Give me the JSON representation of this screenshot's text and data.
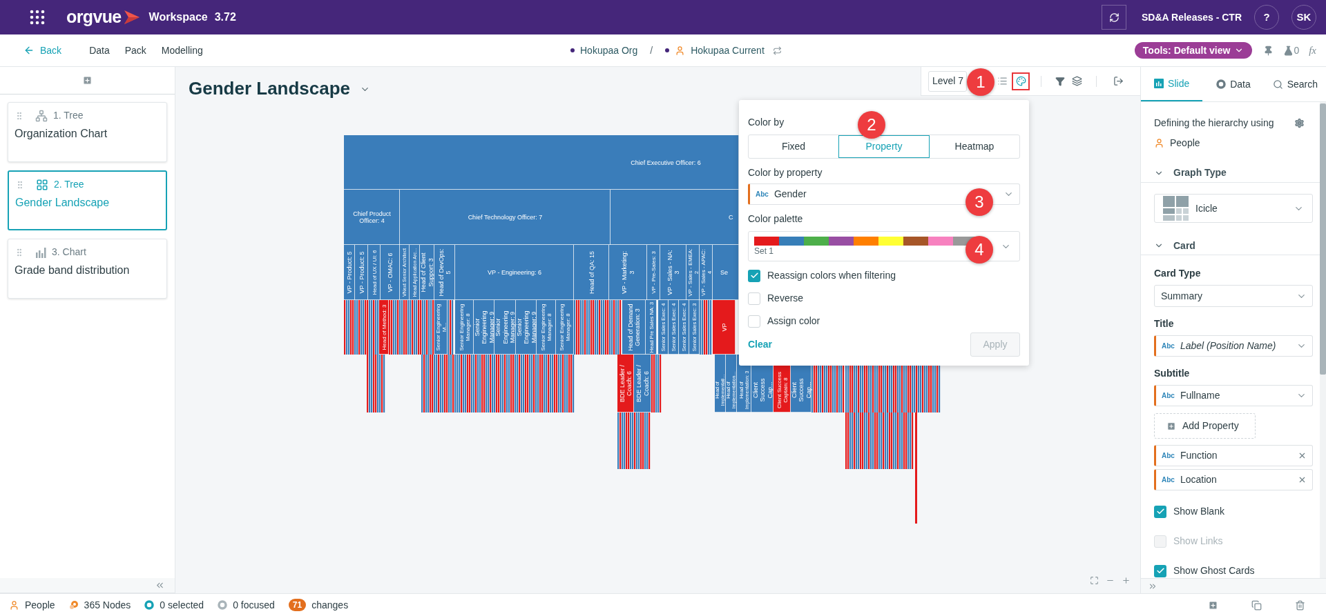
{
  "app": {
    "logo": "orgvue",
    "product": "Workspace",
    "version": "3.72",
    "workspace": "SD&A Releases - CTR",
    "help": "?",
    "user_initials": "SK"
  },
  "nav": {
    "back": "Back",
    "links": [
      "Data",
      "Pack",
      "Modelling"
    ],
    "breadcrumb": [
      {
        "kind": "org",
        "label": "Hokupaa Org"
      },
      {
        "kind": "dataset",
        "label": "Hokupaa Current"
      }
    ],
    "separator": "/",
    "tools": "Tools: Default view",
    "flask_count": "0",
    "fx": "fx"
  },
  "slides": [
    {
      "kind": "tree",
      "number": "1. Tree",
      "title": "Organization Chart",
      "selected": false
    },
    {
      "kind": "icicle",
      "number": "2. Tree",
      "title": "Gender Landscape",
      "selected": true
    },
    {
      "kind": "chart",
      "number": "3. Chart",
      "title": "Grade band distribution",
      "selected": false
    }
  ],
  "canvas": {
    "title": "Gender Landscape",
    "level": "Level 7"
  },
  "icicle": {
    "nodes": [
      {
        "label": "Chief Executive Officer: 6",
        "color": "#3a7dba"
      },
      {
        "label": "Chief Product Officer: 4",
        "color": "#3a7dba"
      },
      {
        "label": "Chief Technology Officer: 7",
        "color": "#3a7dba"
      },
      {
        "label": "C",
        "color": "#3a7dba"
      },
      {
        "label": "VP - Product: 5",
        "color": "#3a7dba"
      },
      {
        "label": "VP - Product: 5",
        "color": "#3a7dba"
      },
      {
        "label": "Head of UX / UI: 6",
        "color": "#3a7dba"
      },
      {
        "label": "VP - OMAC: 6",
        "color": "#3a7dba"
      },
      {
        "label": "VNext Senior Architect",
        "color": "#3a7dba"
      },
      {
        "label": "Head Application Arc...",
        "color": "#3a7dba"
      },
      {
        "label": "Head of Client Support: 3",
        "color": "#3a7dba"
      },
      {
        "label": "Head of DevOps: 5",
        "color": "#3a7dba"
      },
      {
        "label": "VP - Engineering: 6",
        "color": "#3a7dba"
      },
      {
        "label": "Head of QA: 15",
        "color": "#3a7dba"
      },
      {
        "label": "VP - Marketing: 3",
        "color": "#3a7dba"
      },
      {
        "label": "VP - Pre-Sales: 3",
        "color": "#3a7dba"
      },
      {
        "label": "VP - Sales - NA: 3",
        "color": "#3a7dba"
      },
      {
        "label": "VP - Sales - EMEA: 2",
        "color": "#3a7dba"
      },
      {
        "label": "VP - Sales - APAC: 4",
        "color": "#3a7dba"
      },
      {
        "label": "Se",
        "color": "#3a7dba"
      },
      {
        "label": "Head of Method: 3",
        "color": "#e41a1c"
      },
      {
        "label": "Senior Engineering M...",
        "color": "#3a7dba"
      },
      {
        "label": "Senior Engineering Manager: 8",
        "color": "#3a7dba"
      },
      {
        "label": "Senior Engineering Manager: 9",
        "color": "#3a7dba"
      },
      {
        "label": "Senior Engineering Manager: 9",
        "color": "#3a7dba"
      },
      {
        "label": "Senior Engineering Manager: 9",
        "color": "#3a7dba"
      },
      {
        "label": "Senior Engineering Manager: 8",
        "color": "#3a7dba"
      },
      {
        "label": "Senior Engineering Manager: 8",
        "color": "#3a7dba"
      },
      {
        "label": "Head of Demand Generation: 3",
        "color": "#3a7dba"
      },
      {
        "label": "Head Pre Sales NA: 3",
        "color": "#3a7dba"
      },
      {
        "label": "Senior Sales Exec: 4",
        "color": "#3a7dba"
      },
      {
        "label": "Senior Sales Exec: 4",
        "color": "#3a7dba"
      },
      {
        "label": "Senior Sales Exec: 4",
        "color": "#3a7dba"
      },
      {
        "label": "Senior Sales Exec: 3",
        "color": "#3a7dba"
      },
      {
        "label": "VP",
        "color": "#e41a1c"
      },
      {
        "label": "BDE Leader / Coach: 6",
        "color": "#e41a1c"
      },
      {
        "label": "BDE Leader / Coach: 6",
        "color": "#3a7dba"
      },
      {
        "label": "Head of Implementati...",
        "color": "#3a7dba"
      },
      {
        "label": "Head of Implementation...",
        "color": "#3a7dba"
      },
      {
        "label": "Head of Implementation: 3",
        "color": "#3a7dba"
      },
      {
        "label": "Client Success Cap...",
        "color": "#3a7dba"
      },
      {
        "label": "Client Success Captain: 8",
        "color": "#e41a1c"
      },
      {
        "label": "Client Success Cap...",
        "color": "#3a7dba"
      }
    ]
  },
  "color_panel": {
    "title": "Color by",
    "modes": [
      {
        "label": "Fixed",
        "selected": false
      },
      {
        "label": "Property",
        "selected": true
      },
      {
        "label": "Heatmap",
        "selected": false
      }
    ],
    "property_label": "Color by property",
    "property_tag": "Abc",
    "property": "Gender",
    "palette_label": "Color palette",
    "palette": [
      {
        "color": "#e41a1c"
      },
      {
        "color": "#377eb8"
      },
      {
        "color": "#4daf4a"
      },
      {
        "color": "#984ea3"
      },
      {
        "color": "#ff7f00"
      },
      {
        "color": "#ffff33"
      },
      {
        "color": "#a65628"
      },
      {
        "color": "#f781bf"
      },
      {
        "color": "#999999"
      }
    ],
    "palette_name": "Set 1",
    "options": [
      {
        "label": "Reassign colors when filtering",
        "checked": true
      },
      {
        "label": "Reverse",
        "checked": false
      },
      {
        "label": "Assign color",
        "checked": false
      }
    ],
    "clear": "Clear",
    "apply": "Apply",
    "apply_disabled": true
  },
  "markers": [
    "1",
    "2",
    "3",
    "4"
  ],
  "side_panel": {
    "tabs": [
      {
        "kind": "slide",
        "label": "Slide",
        "selected": true
      },
      {
        "kind": "data",
        "label": "Data",
        "selected": false
      },
      {
        "kind": "search",
        "label": "Search",
        "selected": false
      }
    ],
    "hierarchy_text": "Defining the hierarchy using",
    "hierarchy_source": "People",
    "graph_type": {
      "title": "Graph Type",
      "expanded": true,
      "value": "Icicle"
    },
    "card": {
      "title": "Card",
      "expanded": true,
      "card_type_label": "Card Type",
      "card_type": "Summary",
      "title_label": "Title",
      "title_tag": "Abc",
      "title_value": "Label (Position Name)",
      "subtitle_label": "Subtitle",
      "subtitle_tag": "Abc",
      "subtitle_value": "Fullname",
      "add_property": "Add Property",
      "properties": [
        {
          "tag": "Abc",
          "label": "Function"
        },
        {
          "tag": "Abc",
          "label": "Location"
        }
      ]
    },
    "options": [
      {
        "label": "Show Blank",
        "checked": true,
        "disabled": false
      },
      {
        "label": "Show Links",
        "checked": false,
        "disabled": true
      },
      {
        "label": "Show Ghost Cards",
        "checked": true,
        "disabled": false
      }
    ]
  },
  "status_bar": {
    "items": [
      {
        "kind": "people",
        "label": "People"
      },
      {
        "kind": "nodes",
        "label": "365 Nodes"
      },
      {
        "kind": "selected",
        "label": "0 selected"
      },
      {
        "kind": "focused",
        "label": "0 focused"
      },
      {
        "kind": "changes",
        "count": "71",
        "label": "changes"
      }
    ]
  }
}
